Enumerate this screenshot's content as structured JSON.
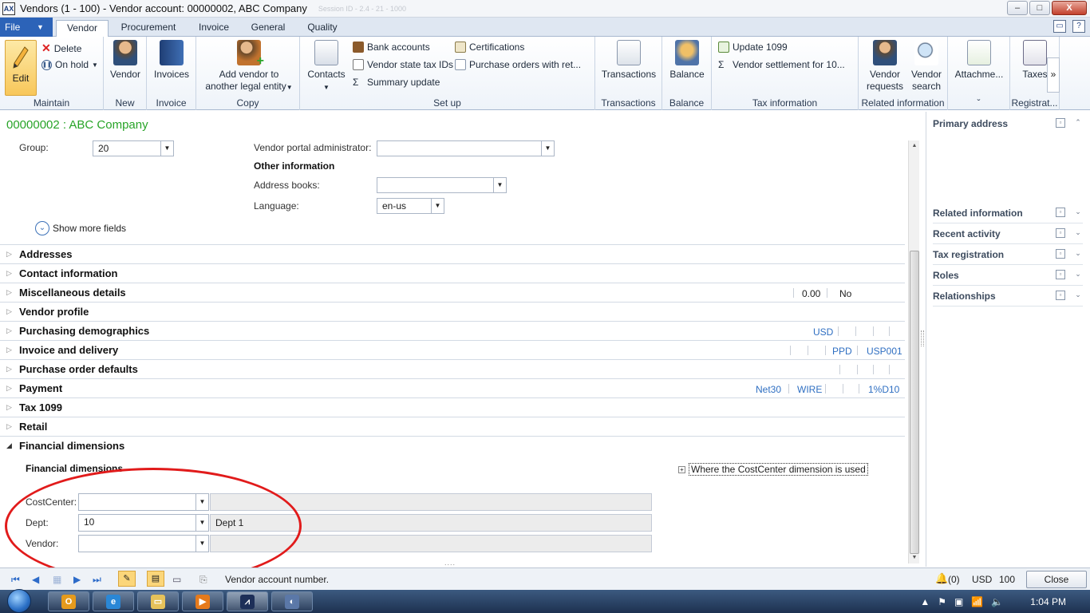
{
  "window": {
    "title": "Vendors (1 - 100) - Vendor account: 00000002, ABC Company",
    "session": "Session ID - 2.4 - 21 - 1000",
    "controls": [
      "–",
      "□",
      "X"
    ]
  },
  "ribbon_tabs": {
    "file": "File",
    "tabs": [
      "Vendor",
      "Procurement",
      "Invoice",
      "General",
      "Quality"
    ],
    "active": "Vendor"
  },
  "ribbon": {
    "maintain": {
      "edit": "Edit",
      "delete": "Delete",
      "on_hold": "On hold",
      "label": "Maintain"
    },
    "new": {
      "vendor": "Vendor",
      "label": "New"
    },
    "invoice": {
      "invoices": "Invoices",
      "label": "Invoice"
    },
    "copy": {
      "add_vendor_1": "Add vendor to",
      "add_vendor_2": "another legal entity",
      "label": "Copy"
    },
    "setup": {
      "contacts": "Contacts",
      "bank_accounts": "Bank accounts",
      "vendor_state_tax": "Vendor state tax IDs",
      "summary_update": "Summary update",
      "certifications": "Certifications",
      "po_with_ret": "Purchase orders with ret...",
      "label": "Set up"
    },
    "transactions": {
      "button": "Transactions",
      "label": "Transactions"
    },
    "balance": {
      "button": "Balance",
      "label": "Balance"
    },
    "tax_information": {
      "update_1099": "Update 1099",
      "settlement": "Vendor settlement for 10...",
      "label": "Tax information"
    },
    "related": {
      "vendor_requests_1": "Vendor",
      "vendor_requests_2": "requests",
      "vendor_search_1": "Vendor",
      "vendor_search_2": "search",
      "label": "Related information"
    },
    "attachments": {
      "button": "Attachme...",
      "label": "ˇ"
    },
    "registration": {
      "taxes": "Taxes",
      "label": "Registrat..."
    },
    "more": "»"
  },
  "record": {
    "title": "00000002 : ABC Company"
  },
  "general": {
    "group_label": "Group:",
    "group_value": "20",
    "vendor_portal_admin_label": "Vendor portal administrator:",
    "vendor_portal_admin_value": "",
    "other_information": "Other information",
    "address_books_label": "Address books:",
    "address_books_value": "",
    "language_label": "Language:",
    "language_value": "en-us",
    "show_more": "Show more fields"
  },
  "fasttabs": [
    {
      "title": "Addresses",
      "expanded": false
    },
    {
      "title": "Contact information",
      "expanded": false
    },
    {
      "title": "Miscellaneous details",
      "expanded": false,
      "summary": [
        "0.00",
        "No"
      ]
    },
    {
      "title": "Vendor profile",
      "expanded": false
    },
    {
      "title": "Purchasing demographics",
      "expanded": false,
      "summary": [
        "USD"
      ]
    },
    {
      "title": "Invoice and delivery",
      "expanded": false,
      "summary": [
        "PPD",
        "USP001"
      ]
    },
    {
      "title": "Purchase order defaults",
      "expanded": false
    },
    {
      "title": "Payment",
      "expanded": false,
      "summary": [
        "Net30",
        "WIRE",
        "1%D10"
      ]
    },
    {
      "title": "Tax 1099",
      "expanded": false
    },
    {
      "title": "Retail",
      "expanded": false
    },
    {
      "title": "Financial dimensions",
      "expanded": true
    }
  ],
  "financial_dimensions": {
    "heading": "Financial dimensions",
    "where_used": "Where the CostCenter dimension is used",
    "rows": [
      {
        "label": "CostCenter:",
        "value": "",
        "description": ""
      },
      {
        "label": "Dept:",
        "value": "10",
        "description": "Dept 1"
      },
      {
        "label": "Vendor:",
        "value": "",
        "description": ""
      }
    ]
  },
  "factbox": {
    "items": [
      "Primary address",
      "Related information",
      "Recent activity",
      "Tax registration",
      "Roles",
      "Relationships"
    ]
  },
  "statusbar": {
    "message": "Vendor account number.",
    "notifications": "(0)",
    "currency": "USD",
    "company": "100",
    "close": "Close"
  },
  "taskbar": {
    "time": "1:04 PM"
  },
  "colors": {
    "accent_blue": "#2c63b8",
    "record_title_green": "#28a428",
    "annotation_red": "#e11b1b",
    "summary_blue": "#2f6fc2"
  }
}
